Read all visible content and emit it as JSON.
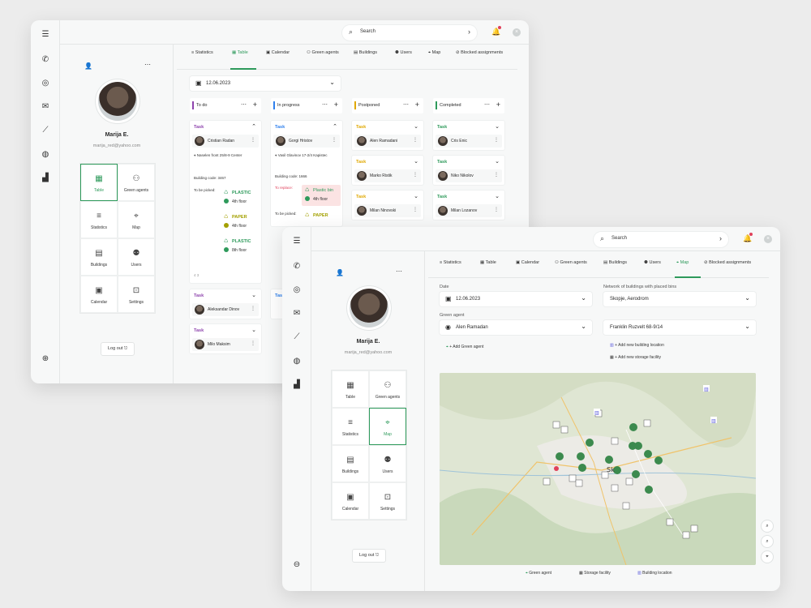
{
  "profile": {
    "name": "Marija E.",
    "email": "marija_red@yahoo.com",
    "logout_label": "Log out"
  },
  "search": {
    "placeholder": "Search"
  },
  "nav_tiles": [
    {
      "label": "Table",
      "icon": "table-icon"
    },
    {
      "label": "Green agents",
      "icon": "people-icon"
    },
    {
      "label": "Statistics",
      "icon": "statistics-icon"
    },
    {
      "label": "Map",
      "icon": "map-pin-icon"
    },
    {
      "label": "Buildings",
      "icon": "building-icon"
    },
    {
      "label": "Users",
      "icon": "users-icon"
    },
    {
      "label": "Calendar",
      "icon": "calendar-icon"
    },
    {
      "label": "Settings",
      "icon": "settings-icon"
    }
  ],
  "tabs": [
    {
      "label": "Statistics"
    },
    {
      "label": "Table"
    },
    {
      "label": "Calendar"
    },
    {
      "label": "Green agents"
    },
    {
      "label": "Buildings"
    },
    {
      "label": "Users"
    },
    {
      "label": "Map"
    },
    {
      "label": "Blocked assignments"
    }
  ],
  "board": {
    "date": "12.06.2023",
    "columns": [
      {
        "name": "To do",
        "color": "#8e44ad"
      },
      {
        "name": "In progress",
        "color": "#2f80ed"
      },
      {
        "name": "Postponed",
        "color": "#e0a800"
      },
      {
        "name": "Completed",
        "color": "#2e9a5b"
      }
    ],
    "todo_cards": [
      {
        "title": "Task",
        "assignee": "Cristian Radan",
        "address": "Naselen front 25/8-9 Center",
        "building_code_label": "Building code:",
        "building_code": "3467",
        "to_pick_label": "To be picked:",
        "bins": [
          {
            "type": "PLASTIC",
            "floor": "4th floor",
            "color": "#2e9a5b"
          },
          {
            "type": "PAPER",
            "floor": "4th floor",
            "color": "#a3a000"
          },
          {
            "type": "PLASTIC",
            "floor": "8th floor",
            "color": "#2e9a5b"
          }
        ],
        "footer": "4   3"
      },
      {
        "title": "Task",
        "assignee": "Aleksandar Dinov"
      },
      {
        "title": "Task",
        "assignee": "Milo Maksim"
      }
    ],
    "progress_cards": [
      {
        "title": "Task",
        "assignee": "Gorgi Hristov",
        "address": "Vasil Glavinov 17-2/4 Kapistec",
        "building_code_label": "Building code:",
        "building_code": "1666",
        "to_replace_label": "To replace:",
        "replace_bin": {
          "type": "Plastic bin",
          "floor": "4th floor"
        },
        "to_pick_label": "To be picked:",
        "pick_bin": {
          "type": "PAPER"
        }
      },
      {
        "title": "Task"
      }
    ],
    "postponed_cards": [
      {
        "title": "Task",
        "assignee": "Alen Ramadani"
      },
      {
        "title": "Task",
        "assignee": "Marko Ristik"
      },
      {
        "title": "Task",
        "assignee": "Milan Ninovski"
      }
    ],
    "completed_cards": [
      {
        "title": "Task",
        "assignee": "Cris Enic"
      },
      {
        "title": "Task",
        "assignee": "Niko Nikolov"
      },
      {
        "title": "Task",
        "assignee": "Milan Lozanov"
      }
    ]
  },
  "map_view": {
    "date_label": "Date",
    "date": "12.06.2023",
    "network_label": "Network of buildings with placed bins",
    "network": "Skopje, Aerodrom",
    "agent_label": "Green agent",
    "agent": "Alen Ramadan",
    "address": "Franklin Ruzvelt 68-9/14",
    "add_agent": "+ Add Green agent",
    "add_building": "+ Add new building location",
    "add_storage": "+ Add new storage facility",
    "map_city_label": "Sk",
    "legend": [
      {
        "label": "Green agent"
      },
      {
        "label": "Storage facility"
      },
      {
        "label": "Building location"
      }
    ]
  },
  "colors": {
    "accent": "#2e9a5b",
    "notification": "#e0405a"
  }
}
